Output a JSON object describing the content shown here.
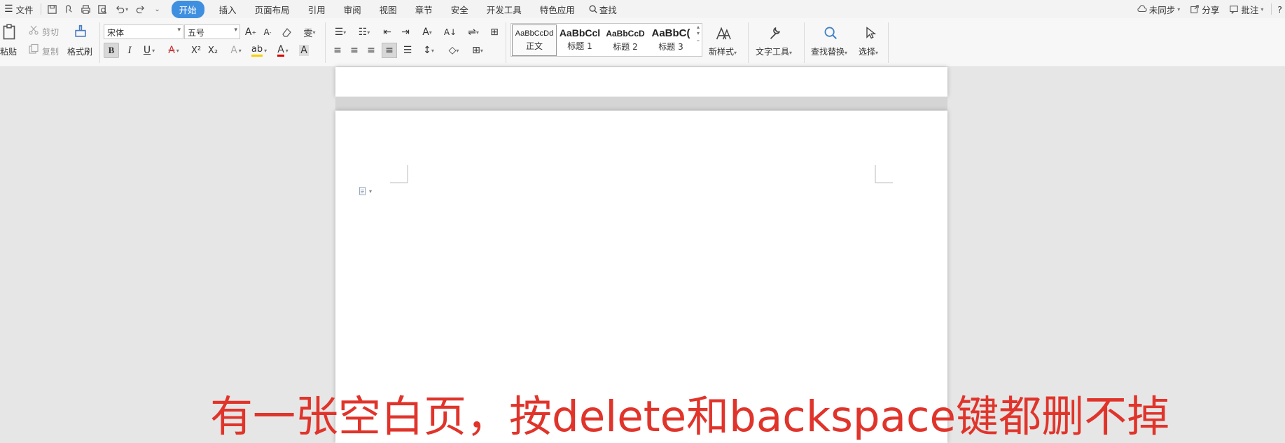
{
  "menubar": {
    "file_label": "文件",
    "tabs": [
      "开始",
      "插入",
      "页面布局",
      "引用",
      "审阅",
      "视图",
      "章节",
      "安全",
      "开发工具",
      "特色应用"
    ],
    "active_tab": "开始",
    "search_label": "查找",
    "right": {
      "sync_label": "未同步",
      "share_label": "分享",
      "comment_label": "批注",
      "help_label": "?"
    }
  },
  "ribbon": {
    "paste_label": "粘贴",
    "cut_label": "剪切",
    "copy_label": "复制",
    "format_painter_label": "格式刷",
    "font_name": "宋体",
    "font_size": "五号",
    "bold": "B",
    "italic": "I",
    "underline": "U",
    "strike": "A",
    "superscript": "X²",
    "subscript": "X₂",
    "styles": [
      {
        "sample": "AaBbCcDd",
        "name": "正文"
      },
      {
        "sample": "AaBbCcl",
        "name": "标题 1"
      },
      {
        "sample": "AaBbCcD",
        "name": "标题 2"
      },
      {
        "sample": "AaBbC(",
        "name": "标题 3"
      }
    ],
    "new_style_label": "新样式",
    "text_tools_label": "文字工具",
    "find_replace_label": "查找替换",
    "select_label": "选择"
  },
  "caption": "有一张空白页，按delete和backspace键都删不掉",
  "colors": {
    "accent": "#3f8fe0",
    "caption": "#e0342b"
  }
}
